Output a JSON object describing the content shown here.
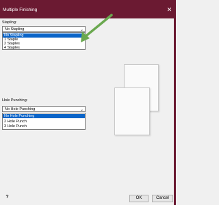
{
  "window": {
    "title": "Multiple Finishing",
    "close_glyph": "✕"
  },
  "stapling": {
    "label": "Stapling:",
    "selected": "No Stapling",
    "options": [
      "No Stapling",
      "1 Staple",
      "2 Staples",
      "4 Staples"
    ]
  },
  "hole_punching": {
    "label": "Hole Punching:",
    "selected": "No Hole Punching",
    "options": [
      "No Hole Punching",
      "2 Hole Punch",
      "3 Hole Punch"
    ]
  },
  "footer": {
    "help_glyph": "?",
    "ok_label": "OK",
    "cancel_label": "Cancel"
  },
  "accent_colors": {
    "titlebar": "#6b1a32",
    "selection": "#0a64c8",
    "annotation_arrow": "#6aa84f"
  },
  "icons": [
    "close-icon",
    "chevron-down-icon",
    "help-icon",
    "arrow-annotation-icon",
    "paper-preview-icon"
  ]
}
